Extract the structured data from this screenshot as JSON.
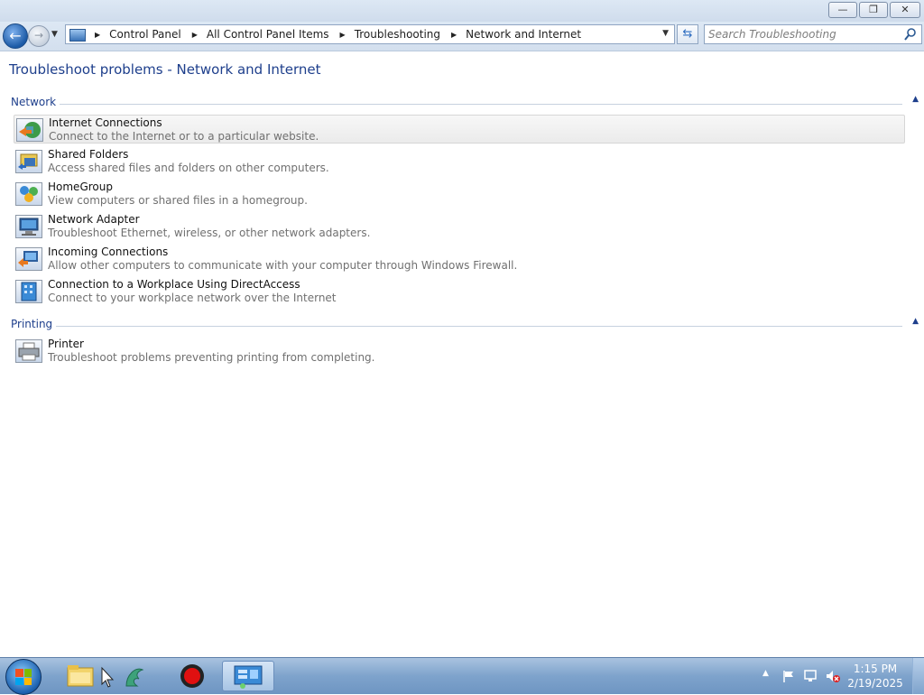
{
  "window": {
    "minimize_glyph": "—",
    "maximize_glyph": "❐",
    "close_glyph": "✕"
  },
  "nav": {
    "breadcrumb": [
      "Control Panel",
      "All Control Panel Items",
      "Troubleshooting",
      "Network and Internet"
    ],
    "search_placeholder": "Search Troubleshooting"
  },
  "page": {
    "title": "Troubleshoot problems - Network and Internet"
  },
  "groups": [
    {
      "label": "Network",
      "items": [
        {
          "title": "Internet Connections",
          "desc": "Connect to the Internet or to a particular website.",
          "icon": "internet-connections-icon",
          "selected": true
        },
        {
          "title": "Shared Folders",
          "desc": "Access shared files and folders on other computers.",
          "icon": "shared-folders-icon"
        },
        {
          "title": "HomeGroup",
          "desc": "View computers or shared files in a homegroup.",
          "icon": "homegroup-icon"
        },
        {
          "title": "Network Adapter",
          "desc": "Troubleshoot Ethernet, wireless, or other network adapters.",
          "icon": "network-adapter-icon"
        },
        {
          "title": "Incoming Connections",
          "desc": "Allow other computers to communicate with your computer through Windows Firewall.",
          "icon": "incoming-connections-icon"
        },
        {
          "title": "Connection to a Workplace Using DirectAccess",
          "desc": "Connect to your workplace network over the Internet",
          "icon": "directaccess-icon"
        }
      ]
    },
    {
      "label": "Printing",
      "items": [
        {
          "title": "Printer",
          "desc": "Troubleshoot problems preventing printing from completing.",
          "icon": "printer-icon"
        }
      ]
    }
  ],
  "taskbar": {
    "time": "1:15 PM",
    "date": "2/19/2025"
  }
}
